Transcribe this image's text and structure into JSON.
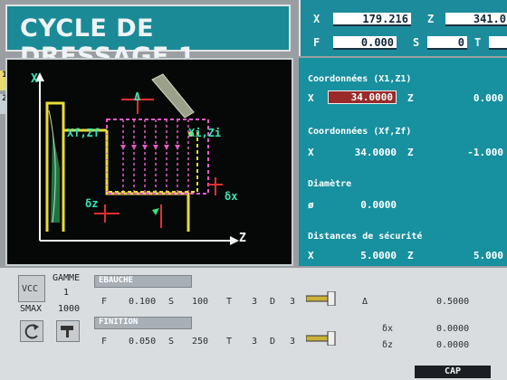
{
  "title": "CYCLE DE DRESSAGE 1",
  "position": {
    "x_label": "X",
    "x_value": "179.216",
    "z_label": "Z",
    "z_value": "341.0",
    "f_label": "F",
    "f_value": "0.000",
    "s_label": "S",
    "s_value": "0",
    "t_label": "T",
    "t_value": ""
  },
  "graphic": {
    "axis_x": "X",
    "axis_z": "Z",
    "label_delta": "Δ",
    "label_xf_zf": "Xf,Zf",
    "label_xi_zi": "Xi,Zi",
    "label_dz": "δz",
    "label_dx": "δx",
    "side_tab_1": "1",
    "side_tab_2": "2"
  },
  "right_panel": {
    "initial": {
      "heading": "Coordonnées (X1,Z1)",
      "x_label": "X",
      "x_value": "34.0000",
      "z_label": "Z",
      "z_value": "0.000"
    },
    "final": {
      "heading": "Coordonnées (Xf,Zf)",
      "x_label": "X",
      "x_value": "34.0000",
      "z_label": "Z",
      "z_value": "-1.000"
    },
    "diameter": {
      "heading": "Diamètre",
      "symbol": "ø",
      "value": "0.0000"
    },
    "safety": {
      "heading": "Distances de sécurité",
      "x_label": "X",
      "x_value": "5.0000",
      "z_label": "Z",
      "z_value": "5.000"
    }
  },
  "bottom": {
    "vcc": "VCC",
    "gamme_label": "GAMME",
    "gamme_value": "1",
    "smax_label": "SMAX",
    "smax_value": "1000",
    "ebauche": {
      "label": "EBAUCHE",
      "f_label": "F",
      "f_value": "0.100",
      "s_label": "S",
      "s_value": "100",
      "t_label": "T",
      "t_value": "3",
      "d_label": "D",
      "d_value": "3",
      "delta_label": "Δ",
      "delta_value": "0.5000"
    },
    "finition": {
      "label": "FINITION",
      "f_label": "F",
      "f_value": "0.050",
      "s_label": "S",
      "s_value": "250",
      "t_label": "T",
      "t_value": "3",
      "d_label": "D",
      "d_value": "3",
      "dx_label": "δx",
      "dx_value": "0.0000",
      "dz_label": "δz",
      "dz_value": "0.0000"
    },
    "softkey_cap": "CAP"
  }
}
